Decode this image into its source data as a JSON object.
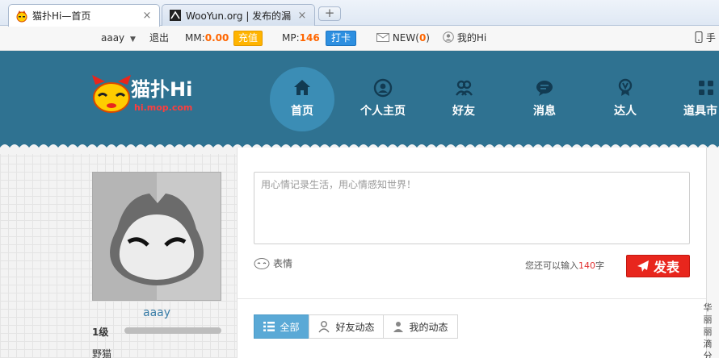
{
  "browser": {
    "tabs": [
      {
        "title": "猫扑Hi—首页",
        "close": "×"
      },
      {
        "title": "WooYun.org | 发布的漏",
        "close": "×"
      }
    ],
    "new_tab": "+"
  },
  "topbar": {
    "username": "aaay",
    "logout": "退出",
    "mm_label": "MM:",
    "mm_value": "0.00",
    "charge": "充值",
    "mp_label": "MP:",
    "mp_value": "146",
    "checkin": "打卡",
    "new_label": "NEW(",
    "new_count": "0",
    "new_close": ")",
    "my_hi": "我的Hi",
    "mobile": "手"
  },
  "logo": {
    "text": "猫扑Hi",
    "sub": "hi.mop.com"
  },
  "nav": [
    {
      "label": "首页",
      "icon": "home-icon"
    },
    {
      "label": "个人主页",
      "icon": "user-circle-icon"
    },
    {
      "label": "好友",
      "icon": "friends-icon"
    },
    {
      "label": "消息",
      "icon": "message-icon"
    },
    {
      "label": "达人",
      "icon": "badge-icon"
    },
    {
      "label": "道具市",
      "icon": "apps-icon"
    }
  ],
  "profile": {
    "username": "aaay",
    "level": "1级",
    "rank": "野猫",
    "level_progress": 0
  },
  "composer": {
    "placeholder": "用心情记录生活，用心情感知世界！",
    "emoji": "表情",
    "remain_prefix": "您还可以输入",
    "remain_count": "140",
    "remain_suffix": "字",
    "post": "发表"
  },
  "filters": [
    {
      "label": "全部",
      "icon": "list-icon"
    },
    {
      "label": "好友动态",
      "icon": "friend-icon"
    },
    {
      "label": "我的动态",
      "icon": "person-icon"
    }
  ],
  "sidebar_text": "华丽丽滴分",
  "colors": {
    "header": "#2f7291",
    "accent": "#ff6600",
    "post_button": "#e8261d",
    "active_filter": "#5aa9d6"
  }
}
